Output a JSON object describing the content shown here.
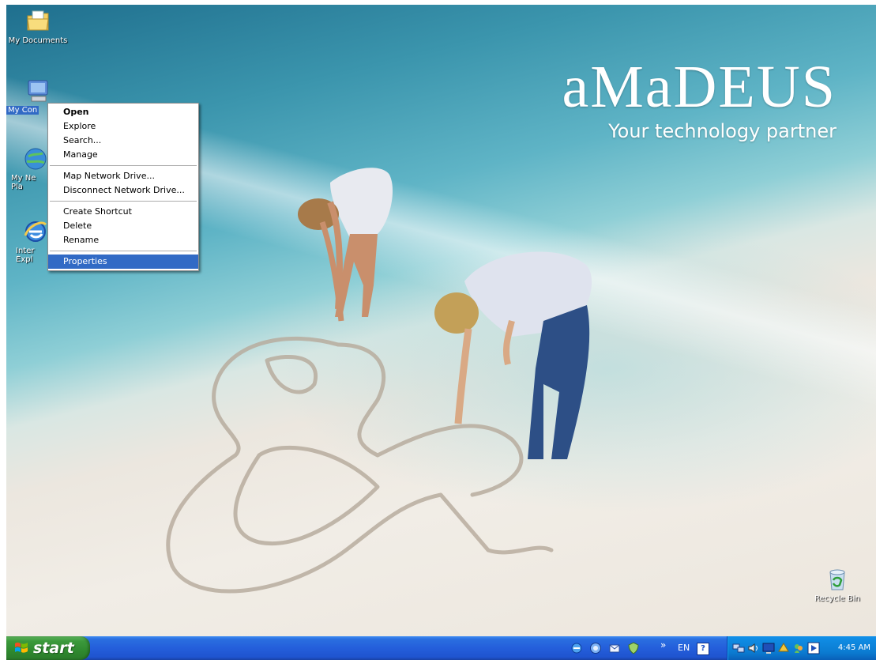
{
  "desktop": {
    "brand": {
      "name": "aMaDEUS",
      "tagline": "Your technology partner"
    },
    "icons": [
      {
        "label": "My Documents",
        "icon": "my-documents-icon"
      },
      {
        "label": "My Con",
        "icon": "my-computer-icon",
        "selected": true
      },
      {
        "label": "My Ne\nPla",
        "icon": "my-network-places-icon"
      },
      {
        "label": "Inter\nExpl",
        "icon": "internet-explorer-icon"
      },
      {
        "label": "Recycle Bin",
        "icon": "recycle-bin-icon"
      }
    ]
  },
  "context_menu": {
    "groups": [
      [
        "Open",
        "Explore",
        "Search...",
        "Manage"
      ],
      [
        "Map Network Drive...",
        "Disconnect Network Drive..."
      ],
      [
        "Create Shortcut",
        "Delete",
        "Rename"
      ],
      [
        "Properties"
      ]
    ],
    "default_item": "Open",
    "highlighted_item": "Properties"
  },
  "taskbar": {
    "start_label": "start",
    "language": "EN",
    "help_glyph": "?",
    "chevron": "»",
    "clock": "4:45 AM",
    "quick_launch_icons": [
      "internet-explorer-icon",
      "browser-icon",
      "outlook-icon",
      "shield-icon"
    ],
    "tray_icons": [
      "network-icon",
      "volume-icon",
      "monitor-icon",
      "security-icon",
      "messenger-icon",
      "media-icon"
    ],
    "colors": {
      "taskbar_blue": "#245edb",
      "start_green": "#3c9a3c",
      "tray_blue": "#0f8ae1",
      "selection_blue": "#316ac5"
    }
  }
}
